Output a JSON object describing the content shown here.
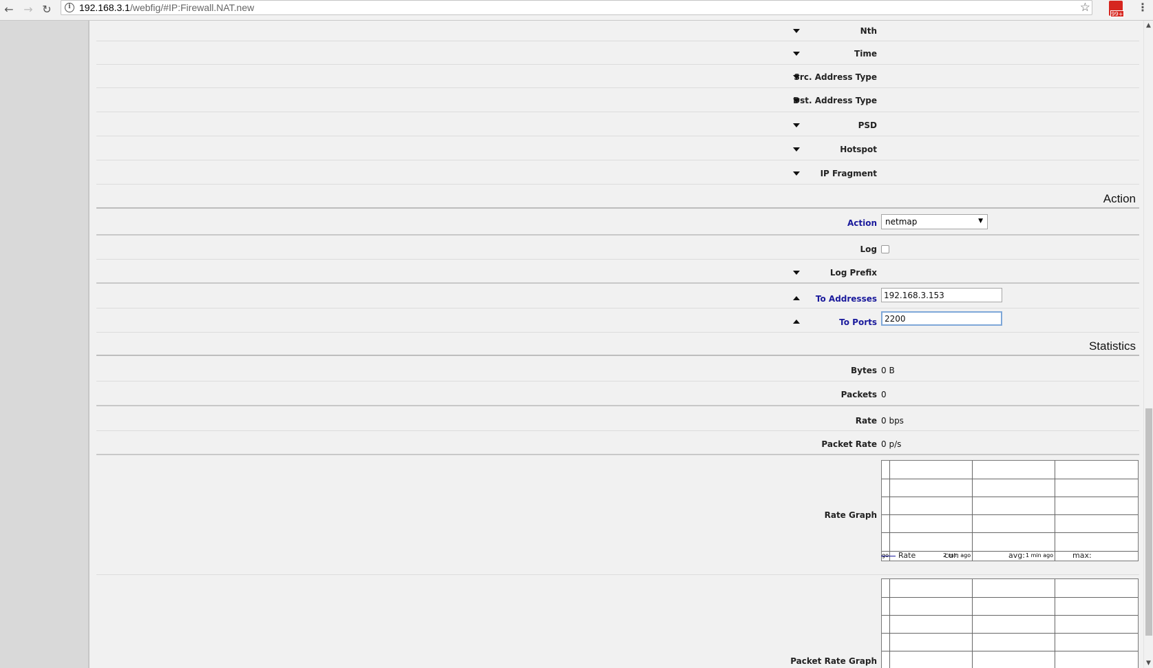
{
  "browser": {
    "url_host": "192.168.3.1",
    "url_path": "/webfig/#IP:Firewall.NAT.new",
    "ext_badge": "99+"
  },
  "collapsed_fields": [
    {
      "label": "Nth"
    },
    {
      "label": "Time"
    },
    {
      "label": "Src. Address Type"
    },
    {
      "label": "Dst. Address Type"
    },
    {
      "label": "PSD"
    },
    {
      "label": "Hotspot"
    },
    {
      "label": "IP Fragment"
    }
  ],
  "action_section": {
    "title": "Action",
    "action_label": "Action",
    "action_value": "netmap",
    "log_label": "Log",
    "log_checked": false,
    "log_prefix_label": "Log Prefix",
    "to_addresses_label": "To Addresses",
    "to_addresses_value": "192.168.3.153",
    "to_ports_label": "To Ports",
    "to_ports_value": "2200"
  },
  "statistics_section": {
    "title": "Statistics",
    "bytes_label": "Bytes",
    "bytes_value": "0 B",
    "packets_label": "Packets",
    "packets_value": "0",
    "rate_label": "Rate",
    "rate_value": "0 bps",
    "packet_rate_label": "Packet Rate",
    "packet_rate_value": "0 p/s",
    "rate_graph_label": "Rate Graph",
    "rate_graph": {
      "x_labels": [
        "go",
        "2 min ago",
        "1 min ago"
      ],
      "legend_series": "Rate",
      "legend_cur": "cur:",
      "legend_avg": "avg:",
      "legend_max": "max:"
    },
    "packet_rate_graph_label": "Packet Rate Graph"
  },
  "colors": {
    "highlight_label": "#1a1a9c",
    "sidebar": "#d9d9d9",
    "background": "#f1f1f1"
  }
}
